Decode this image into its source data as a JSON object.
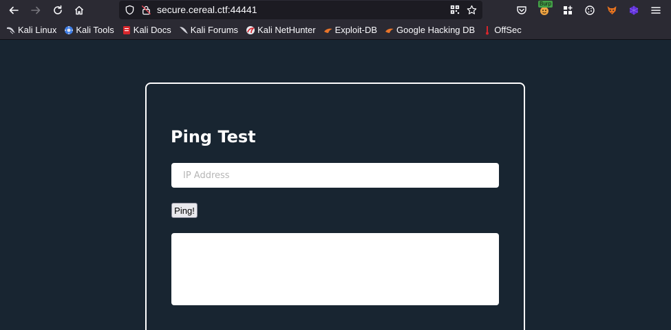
{
  "browser": {
    "url": "secure.cereal.ctf:44441",
    "burp_badge": "Burp",
    "bookmarks": [
      {
        "label": "Kali Linux",
        "icon": "kali-dragon-icon"
      },
      {
        "label": "Kali Tools",
        "icon": "kali-tools-icon"
      },
      {
        "label": "Kali Docs",
        "icon": "kali-docs-icon"
      },
      {
        "label": "Kali Forums",
        "icon": "kali-forums-icon"
      },
      {
        "label": "Kali NetHunter",
        "icon": "nethunter-icon"
      },
      {
        "label": "Exploit-DB",
        "icon": "exploit-db-icon"
      },
      {
        "label": "Google Hacking DB",
        "icon": "ghdb-icon"
      },
      {
        "label": "OffSec",
        "icon": "offsec-icon"
      }
    ]
  },
  "page": {
    "title": "Ping Test",
    "ip_placeholder": "IP Address",
    "ip_value": "",
    "ping_label": "Ping!",
    "output": ""
  },
  "colors": {
    "page_background": "#182531",
    "toolbar_background": "#2b2a33",
    "urlbar_background": "#1c1b22",
    "card_border": "#ffffff"
  }
}
